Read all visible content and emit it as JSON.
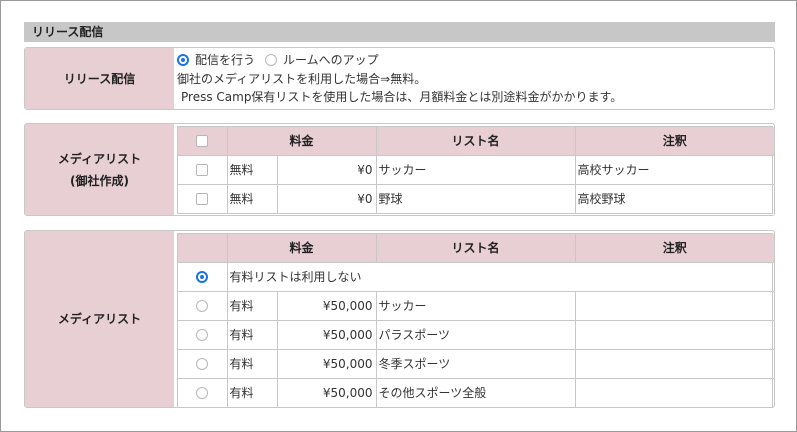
{
  "section": {
    "title": "リリース配信"
  },
  "release": {
    "label": "リリース配信",
    "options": [
      {
        "label": "配信を行う",
        "checked": true
      },
      {
        "label": "ルームへのアップ",
        "checked": false
      }
    ],
    "note1": "御社のメディアリストを利用した場合⇒無料。",
    "note2": "Press Camp保有リストを使用した場合は、月額料金とは別途料金がかかります。"
  },
  "own_list": {
    "label_line1": "メディアリスト",
    "label_line2": "(御社作成)",
    "headers": {
      "price": "料金",
      "name": "リスト名",
      "note": "注釈"
    },
    "rows": [
      {
        "type": "無料",
        "price": "¥0",
        "name": "サッカー",
        "note": "高校サッカー"
      },
      {
        "type": "無料",
        "price": "¥0",
        "name": "野球",
        "note": "高校野球"
      }
    ]
  },
  "paid_list": {
    "label": "メディアリスト",
    "headers": {
      "price": "料金",
      "name": "リスト名",
      "note": "注釈"
    },
    "none_option": "有料リストは利用しない",
    "rows": [
      {
        "type": "有料",
        "price": "¥50,000",
        "name": "サッカー",
        "note": ""
      },
      {
        "type": "有料",
        "price": "¥50,000",
        "name": "パラスポーツ",
        "note": ""
      },
      {
        "type": "有料",
        "price": "¥50,000",
        "name": "冬季スポーツ",
        "note": ""
      },
      {
        "type": "有料",
        "price": "¥50,000",
        "name": "その他スポーツ全般",
        "note": ""
      }
    ]
  },
  "colors": {
    "label_bg": "#e8cfd3",
    "header_bg": "#c7c7c7",
    "radio_accent": "#1a73e8"
  }
}
